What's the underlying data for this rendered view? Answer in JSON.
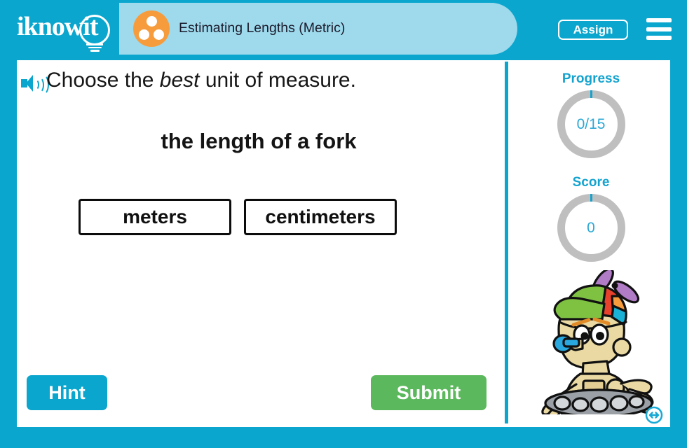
{
  "header": {
    "logo_text": "iknowit",
    "logo_icon": "lightbulb-icon",
    "lesson_icon": "three-dots-circle-icon",
    "title": "Estimating Lengths (Metric)",
    "assign_label": "Assign",
    "menu_icon": "hamburger-menu-icon",
    "bar_color": "#0aa6ce",
    "tab_color": "#9ed9ec",
    "accent_orange": "#f79c3c"
  },
  "question": {
    "speaker_icon": "speaker-audio-icon",
    "prompt_before": "Choose the ",
    "prompt_emphasis": "best",
    "prompt_after": " unit of measure.",
    "text": "the length of a fork"
  },
  "options": [
    {
      "label": "meters"
    },
    {
      "label": "centimeters"
    }
  ],
  "actions": {
    "hint_label": "Hint",
    "hint_color": "#0aa6ce",
    "submit_label": "Submit",
    "submit_color": "#5cb85c"
  },
  "sidebar": {
    "progress": {
      "label": "Progress",
      "value": "0/15",
      "completed": 0,
      "total": 15,
      "ring_color": "#bfbfbf",
      "tick_color": "#14a3cf"
    },
    "score": {
      "label": "Score",
      "value": "0",
      "ring_color": "#bfbfbf",
      "tick_color": "#14a3cf"
    },
    "mascot": "robot-mascot-with-propeller-beanie",
    "resize_icon": "horizontal-resize-arrows-icon"
  }
}
